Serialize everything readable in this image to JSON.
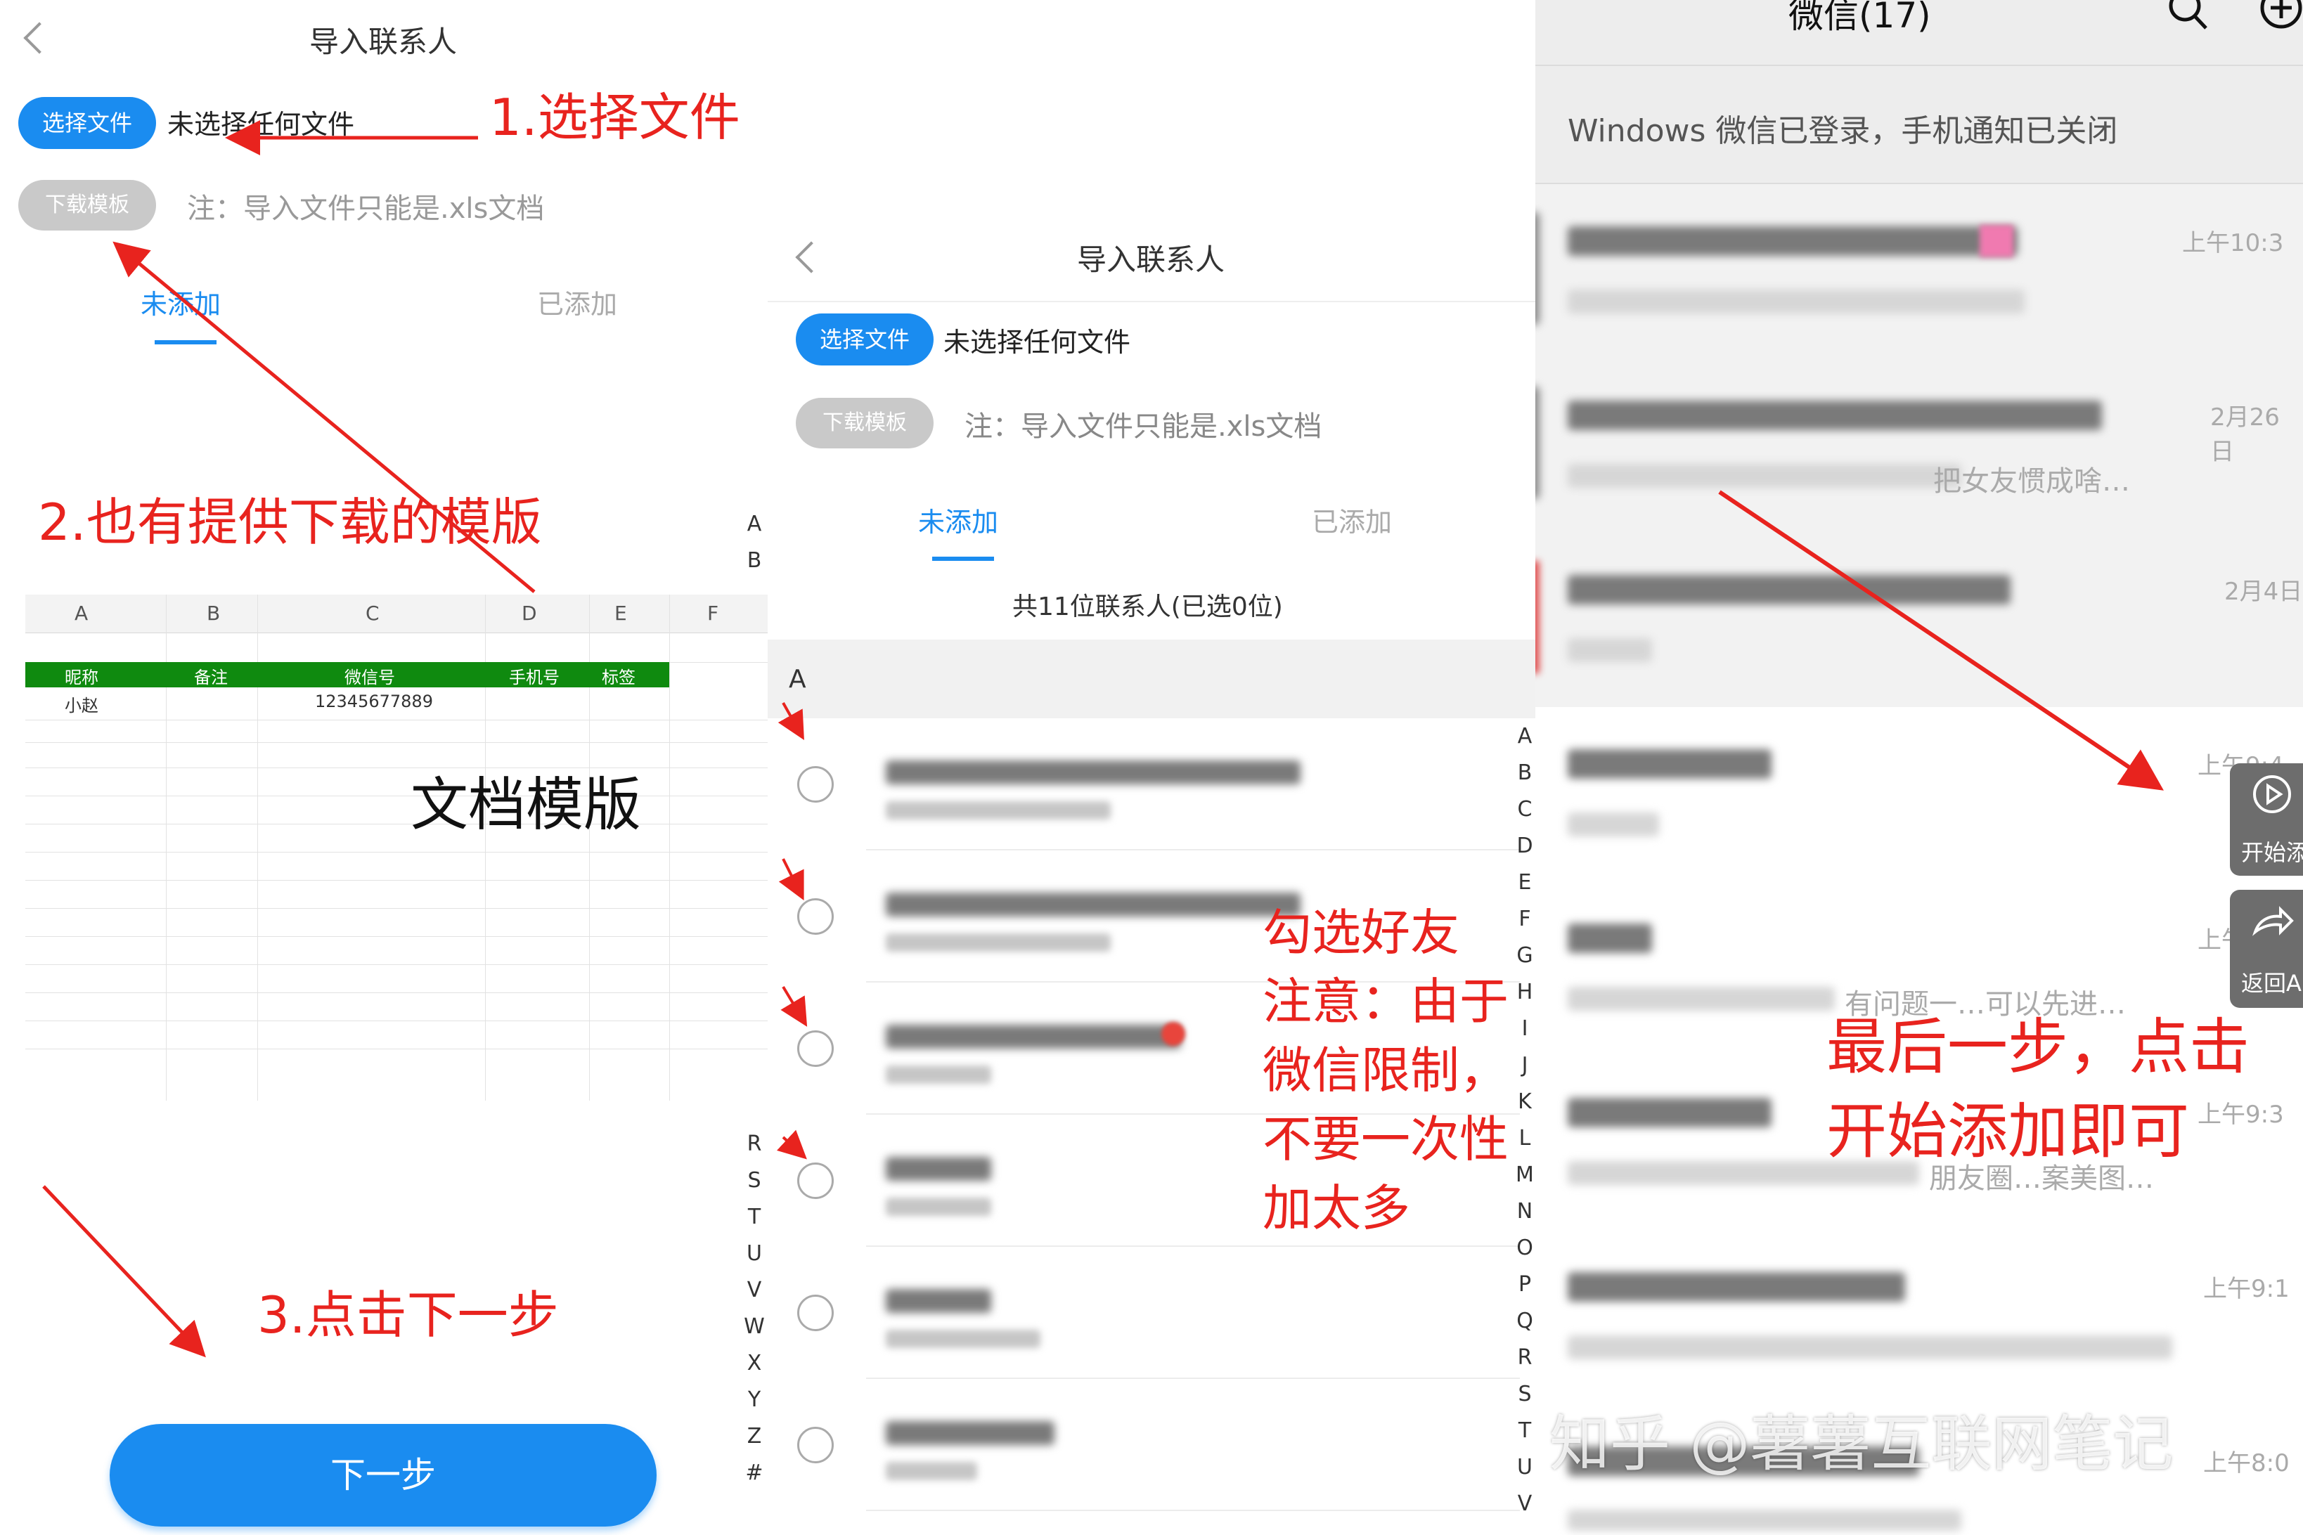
{
  "panel1": {
    "nav_title": "导入联系人",
    "choose_file_btn": "选择文件",
    "no_file_text": "未选择任何文件",
    "download_template_btn": "下载模板",
    "note_text": "注：导入文件只能是.xls文档",
    "tab_unadded": "未添加",
    "tab_added": "已添加",
    "annotation_1": "1.选择文件",
    "annotation_2": "2.也有提供下载的模版",
    "annotation_template": "文档模版",
    "annotation_3": "3.点击下一步",
    "next_btn": "下一步",
    "sheet": {
      "col_letters": [
        "A",
        "B",
        "C",
        "D",
        "E",
        "F"
      ],
      "headers": [
        "昵称",
        "备注",
        "微信号",
        "手机号",
        "标签"
      ],
      "row1": [
        "小赵",
        "",
        "12345677889",
        "",
        ""
      ]
    },
    "alpha_index_top": [
      "A",
      "B"
    ],
    "alpha_index_bottom": [
      "R",
      "S",
      "T",
      "U",
      "V",
      "W",
      "X",
      "Y",
      "Z",
      "#"
    ]
  },
  "panel2": {
    "nav_title": "导入联系人",
    "choose_file_btn": "选择文件",
    "no_file_text": "未选择任何文件",
    "download_template_btn": "下载模板",
    "note_text": "注：导入文件只能是.xls文档",
    "tab_unadded": "未添加",
    "tab_added": "已添加",
    "summary": "共11位联系人(已选0位)",
    "section_letter": "A",
    "annotation_lines": [
      "勾选好友",
      "注意：由于",
      "微信限制，",
      "不要一次性",
      "加太多"
    ],
    "alpha_index": [
      "A",
      "B",
      "C",
      "D",
      "E",
      "F",
      "G",
      "H",
      "I",
      "J",
      "K",
      "L",
      "M",
      "N",
      "O",
      "P",
      "Q",
      "R",
      "S",
      "T",
      "U",
      "V"
    ]
  },
  "panel3": {
    "title": "微信(17)",
    "notice": "Windows 微信已登录，手机通知已关闭",
    "times": [
      "上午10:3",
      "2月26日",
      "2月4日",
      "上午9:4",
      "上午9:",
      "上午9:3",
      "上午9:1",
      "上午8:0"
    ],
    "partial_texts": [
      "把女友惯成啥…",
      "有问题一…可以先进…",
      "朋友圈…案美图…"
    ],
    "tool_start": "开始添",
    "tool_return": "返回A",
    "annotation_lines": [
      "最后一步，点击",
      "开始添加即可"
    ],
    "watermark": "知乎 @薯薯互联网笔记"
  },
  "colors": {
    "blue": "#1a8cf0",
    "red": "#e8231e",
    "sheet_header_green": "#0f8a0f"
  }
}
